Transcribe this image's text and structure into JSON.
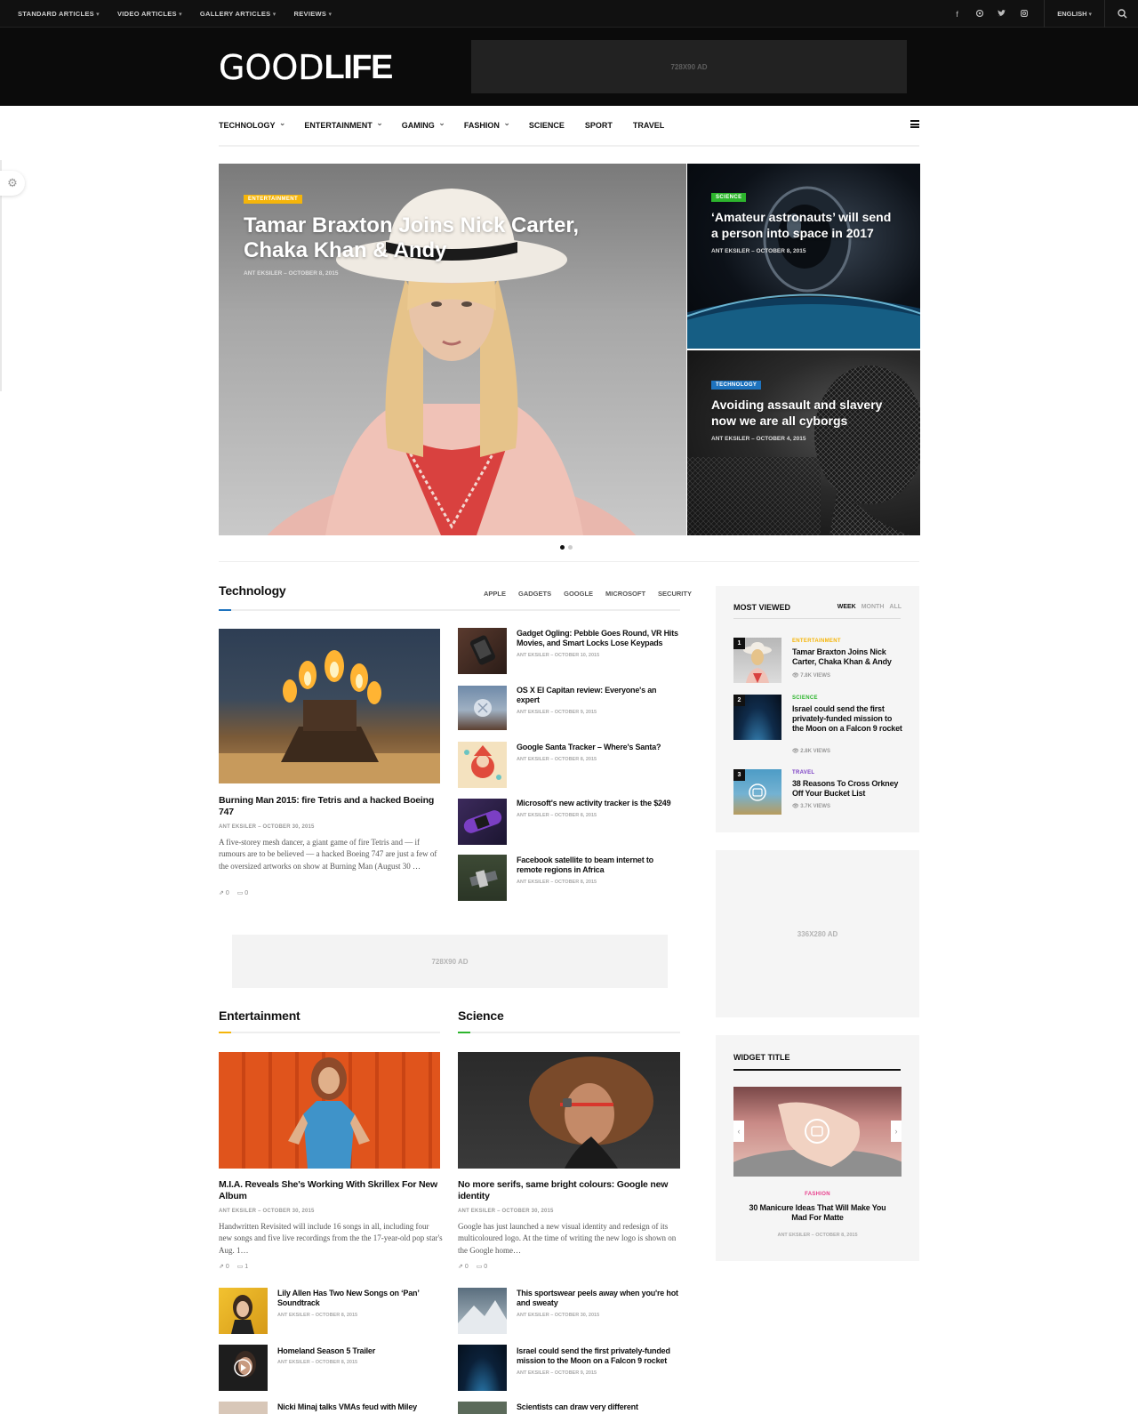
{
  "topbar": {
    "menu": [
      "STANDARD ARTICLES",
      "VIDEO ARTICLES",
      "GALLERY ARTICLES",
      "REVIEWS"
    ],
    "social_icons": [
      "facebook-icon",
      "pinterest-icon",
      "twitter-icon",
      "instagram-icon"
    ],
    "language": "ENGLISH"
  },
  "header": {
    "logo_thin": "GOOD",
    "logo_bold": "LIFE",
    "ad_label": "728X90 AD"
  },
  "nav": {
    "items": [
      {
        "label": "TECHNOLOGY",
        "dropdown": true
      },
      {
        "label": "ENTERTAINMENT",
        "dropdown": true
      },
      {
        "label": "GAMING",
        "dropdown": true
      },
      {
        "label": "FASHION",
        "dropdown": true
      },
      {
        "label": "SCIENCE",
        "dropdown": false
      },
      {
        "label": "SPORT",
        "dropdown": false
      },
      {
        "label": "TRAVEL",
        "dropdown": false
      }
    ]
  },
  "hero": {
    "main": {
      "tag": "ENTERTAINMENT",
      "title": "Tamar Braxton Joins Nick Carter, Chaka Khan & Andy",
      "meta": "ANT EKSILER – OCTOBER 8, 2015"
    },
    "side1": {
      "tag": "SCIENCE",
      "title": "‘Amateur astronauts’ will send a person into space in 2017",
      "meta": "ANT EKSILER – OCTOBER 8, 2015"
    },
    "side2": {
      "tag": "TECHNOLOGY",
      "title": "Avoiding assault and slavery now we are all cyborgs",
      "meta": "ANT EKSILER – OCTOBER 4, 2015"
    }
  },
  "technology": {
    "title": "Technology",
    "tabs": [
      "APPLE",
      "GADGETS",
      "GOOGLE",
      "MICROSOFT",
      "SECURITY"
    ],
    "featured": {
      "title": "Burning Man 2015: fire Tetris and a hacked Boeing 747",
      "meta": "ANT EKSILER – OCTOBER 30, 2015",
      "excerpt": "A five-storey mesh dancer, a giant game of fire Tetris and — if rumours are to be believed — a hacked Boeing 747 are just a few of the oversized artworks on show at Burning Man (August 30 …",
      "shares": "0",
      "comments": "0"
    },
    "list": [
      {
        "title": "Gadget Ogling: Pebble Goes Round, VR Hits Movies, and Smart Locks Lose Keypads",
        "meta": "ANT EKSILER – OCTOBER 10, 2015"
      },
      {
        "title": "OS X El Capitan review: Everyone's an expert",
        "meta": "ANT EKSILER – OCTOBER 9, 2015"
      },
      {
        "title": "Google Santa Tracker – Where's Santa?",
        "meta": "ANT EKSILER – OCTOBER 8, 2015"
      },
      {
        "title": "Microsoft's new activity tracker is the $249",
        "meta": "ANT EKSILER – OCTOBER 8, 2015"
      },
      {
        "title": "Facebook satellite to beam internet to remote regions in Africa",
        "meta": "ANT EKSILER – OCTOBER 8, 2015"
      }
    ]
  },
  "ad_inline": "728X90 AD",
  "entertainment": {
    "title": "Entertainment",
    "featured": {
      "title": "M.I.A. Reveals She's Working With Skrillex For New Album",
      "meta": "ANT EKSILER – OCTOBER 30, 2015",
      "excerpt": "Handwritten Revisited will include 16 songs in all, including four new songs and five live recordings from the the 17-year-old pop star's Aug. 1…",
      "shares": "0",
      "comments": "1"
    },
    "list": [
      {
        "title": "Lily Allen Has Two New Songs on ‘Pan’ Soundtrack",
        "meta": "ANT EKSILER – OCTOBER 8, 2015"
      },
      {
        "title": "Homeland Season 5 Trailer",
        "meta": "ANT EKSILER – OCTOBER 8, 2015"
      },
      {
        "title": "Nicki Minaj talks VMAs feud with Miley",
        "meta": ""
      }
    ]
  },
  "science": {
    "title": "Science",
    "featured": {
      "title": "No more serifs, same bright colours: Google new identity",
      "meta": "ANT EKSILER – OCTOBER 30, 2015",
      "excerpt": "Google has just launched a new visual identity and redesign of its multicoloured logo. At the time of writing the new logo is shown on the Google home…",
      "shares": "0",
      "comments": "0"
    },
    "list": [
      {
        "title": "This sportswear peels away when you're hot and sweaty",
        "meta": "ANT EKSILER – OCTOBER 30, 2015"
      },
      {
        "title": "Israel could send the first privately-funded mission to the Moon on a Falcon 9 rocket",
        "meta": "ANT EKSILER – OCTOBER 9, 2015"
      },
      {
        "title": "Scientists can draw very different",
        "meta": ""
      }
    ]
  },
  "most_viewed": {
    "title": "MOST VIEWED",
    "tabs": [
      "WEEK",
      "MONTH",
      "ALL"
    ],
    "items": [
      {
        "num": "1",
        "cat": "ENTERTAINMENT",
        "cat_color": "#f5b50a",
        "title": "Tamar Braxton Joins Nick Carter, Chaka Khan & Andy",
        "views": "7.8K VIEWS"
      },
      {
        "num": "2",
        "cat": "SCIENCE",
        "cat_color": "#2db52d",
        "title": "Israel could send the first privately-funded mission to the Moon on a Falcon 9 rocket",
        "views": "2.8K VIEWS"
      },
      {
        "num": "3",
        "cat": "TRAVEL",
        "cat_color": "#7b3fc4",
        "title": "38 Reasons To Cross Orkney Off Your Bucket List",
        "views": "3.7K VIEWS"
      }
    ]
  },
  "ad_side": "336X280 AD",
  "widget": {
    "title": "WIDGET TITLE",
    "cat": "FASHION",
    "cat_color": "#e83e8c",
    "post_title": "30 Manicure Ideas That Will Make You Mad For Matte",
    "meta": "ANT EKSILER – OCTOBER 8, 2015"
  },
  "colors": {
    "accent_tech": "#1e73be",
    "accent_ent": "#f5b50a",
    "accent_sci": "#2db52d"
  }
}
